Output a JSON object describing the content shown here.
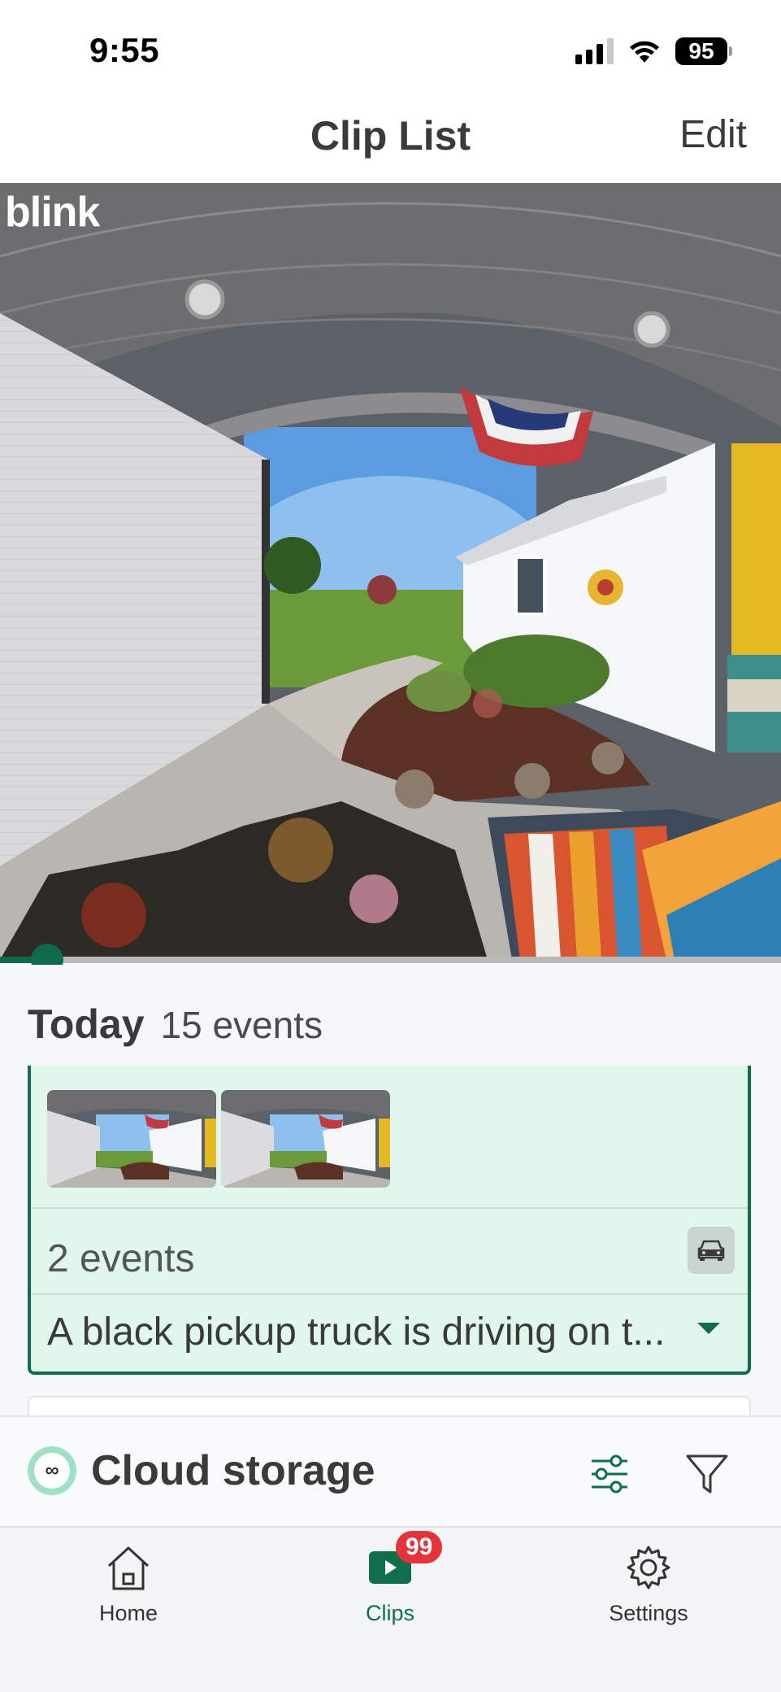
{
  "status_bar": {
    "time": "9:55",
    "battery": "95"
  },
  "header": {
    "title": "Clip List",
    "edit_label": "Edit"
  },
  "video": {
    "brand": "blink",
    "progress": 0.06
  },
  "day_group": {
    "label": "Today",
    "count": "15 events"
  },
  "event_card": {
    "count": "2 events",
    "description": "A black pickup truck is driving on t...",
    "icon": "vehicle-icon",
    "thumbnails": 2
  },
  "storage": {
    "icon_symbol": "∞",
    "label": "Cloud storage"
  },
  "tabs": [
    {
      "label": "Home",
      "icon": "home-icon"
    },
    {
      "label": "Clips",
      "icon": "clips-icon",
      "badge": "99"
    },
    {
      "label": "Settings",
      "icon": "gear-icon"
    }
  ],
  "colors": {
    "accent": "#0f6f4d",
    "card_bg": "#e1f7ec",
    "badge": "#e5323b"
  }
}
